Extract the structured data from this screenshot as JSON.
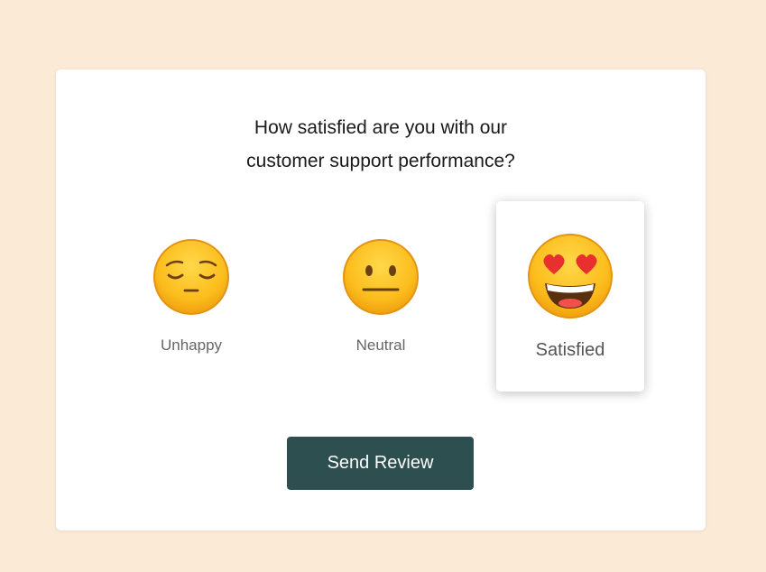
{
  "colors": {
    "page_background": "#fbead6",
    "card_background": "#ffffff",
    "button_background": "#2d4f4f",
    "button_text": "#ffffff",
    "label_text": "#666666"
  },
  "question": {
    "line1": "How satisfied are you with our",
    "line2": "customer support performance?"
  },
  "options": [
    {
      "label": "Unhappy",
      "icon": "pensive-face-icon",
      "selected": false
    },
    {
      "label": "Neutral",
      "icon": "neutral-face-icon",
      "selected": false
    },
    {
      "label": "Satisfied",
      "icon": "heart-eyes-face-icon",
      "selected": true
    }
  ],
  "send_button": {
    "label": "Send Review"
  }
}
